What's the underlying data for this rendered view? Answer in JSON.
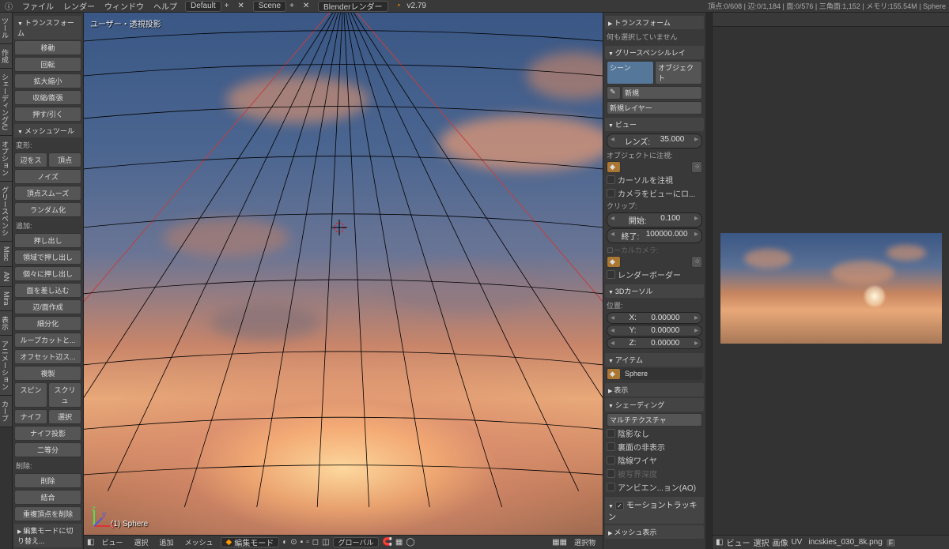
{
  "menubar": {
    "items": [
      "ファイル",
      "レンダー",
      "ウィンドウ",
      "ヘルプ"
    ],
    "layout": "Default",
    "scene": "Scene",
    "renderer": "Blenderレンダー",
    "version": "v2.79",
    "stats": "頂点:0/608 | 辺:0/1,184 | 面:0/576 | 三角面:1,152 | メモリ:155.54M | Sphere"
  },
  "vtabs": [
    "ツール",
    "作成",
    "シェーディング/U",
    "オプション",
    "グリースペンシ",
    "Misc",
    "AN",
    "Mira",
    "表示",
    "アニメーション",
    "カーブ"
  ],
  "toolshelf": {
    "transform_header": "トランスフォーム",
    "transform": [
      "移動",
      "回転",
      "拡大縮小",
      "収縮/膨張",
      "押す/引く"
    ],
    "meshtools_header": "メッシュツール",
    "deform_label": "変形:",
    "deform_row": [
      "辺をス",
      "頂点"
    ],
    "deform": [
      "ノイズ",
      "頂点スムーズ",
      "ランダム化"
    ],
    "add_label": "追加:",
    "add": [
      "押し出し",
      "領域で押し出し",
      "個々に押し出し",
      "面を差し込む",
      "辺/面作成",
      "細分化",
      "ループカットと...",
      "オフセット辺ス...",
      "複製"
    ],
    "add_row1": [
      "スピン",
      "スクリュ"
    ],
    "add_row2": [
      "ナイフ",
      "選択"
    ],
    "add_tail": [
      "ナイフ投影",
      "二等分"
    ],
    "delete_label": "削除:",
    "delete": [
      "削除",
      "結合",
      "重複頂点を削除"
    ],
    "switch": "編集モードに切り替え..."
  },
  "viewport": {
    "label": "ユーザー・透視投影",
    "object": "(1) Sphere"
  },
  "viewport_footer": {
    "items": [
      "ビュー",
      "選択",
      "追加",
      "メッシュ"
    ],
    "mode": "編集モード",
    "orientation": "グローバル",
    "tail": [
      "選択物"
    ]
  },
  "props": {
    "transform_head": "トランスフォーム",
    "transform_msg": "何も選択していません",
    "gp_head": "グリースペンシルレイ",
    "gp_tabs": [
      "シーン",
      "オブジェクト"
    ],
    "gp_btns": [
      "新規"
    ],
    "gp_layer": "新規レイヤー",
    "view_head": "ビュー",
    "lens_label": "レンズ:",
    "lens_value": "35.000",
    "focus_label": "オブジェクトに注視:",
    "focus_btns": [
      "カーソルを注視",
      "カメラをビューにロ..."
    ],
    "clip_label": "クリップ:",
    "clip_start_label": "開始:",
    "clip_start": "0.100",
    "clip_end_label": "終了:",
    "clip_end": "100000.000",
    "local_cam": "ローカルカメラ:",
    "render_border": "レンダーボーダー",
    "cursor_head": "3Dカーソル",
    "pos_label": "位置:",
    "cursor_x_label": "X:",
    "cursor_x": "0.00000",
    "cursor_y_label": "Y:",
    "cursor_y": "0.00000",
    "cursor_z_label": "Z:",
    "cursor_z": "0.00000",
    "item_head": "アイテム",
    "item_name": "Sphere",
    "display_head": "表示",
    "shading_head": "シェーディング",
    "shading_mode": "マルチテクスチャ",
    "shading_opts": [
      "陰影なし",
      "裏面の非表示",
      "陰線ワイヤ",
      "被写界深度",
      "アンビエン...ョン(AO)"
    ],
    "motion": "モーショントラッキン",
    "mesh_display_head": "メッシュ表示"
  },
  "imgview": {
    "footer_items": [
      "ビュー",
      "選択",
      "画像",
      "UV"
    ],
    "filename": "incskies_030_8k.png",
    "flag": "F"
  }
}
